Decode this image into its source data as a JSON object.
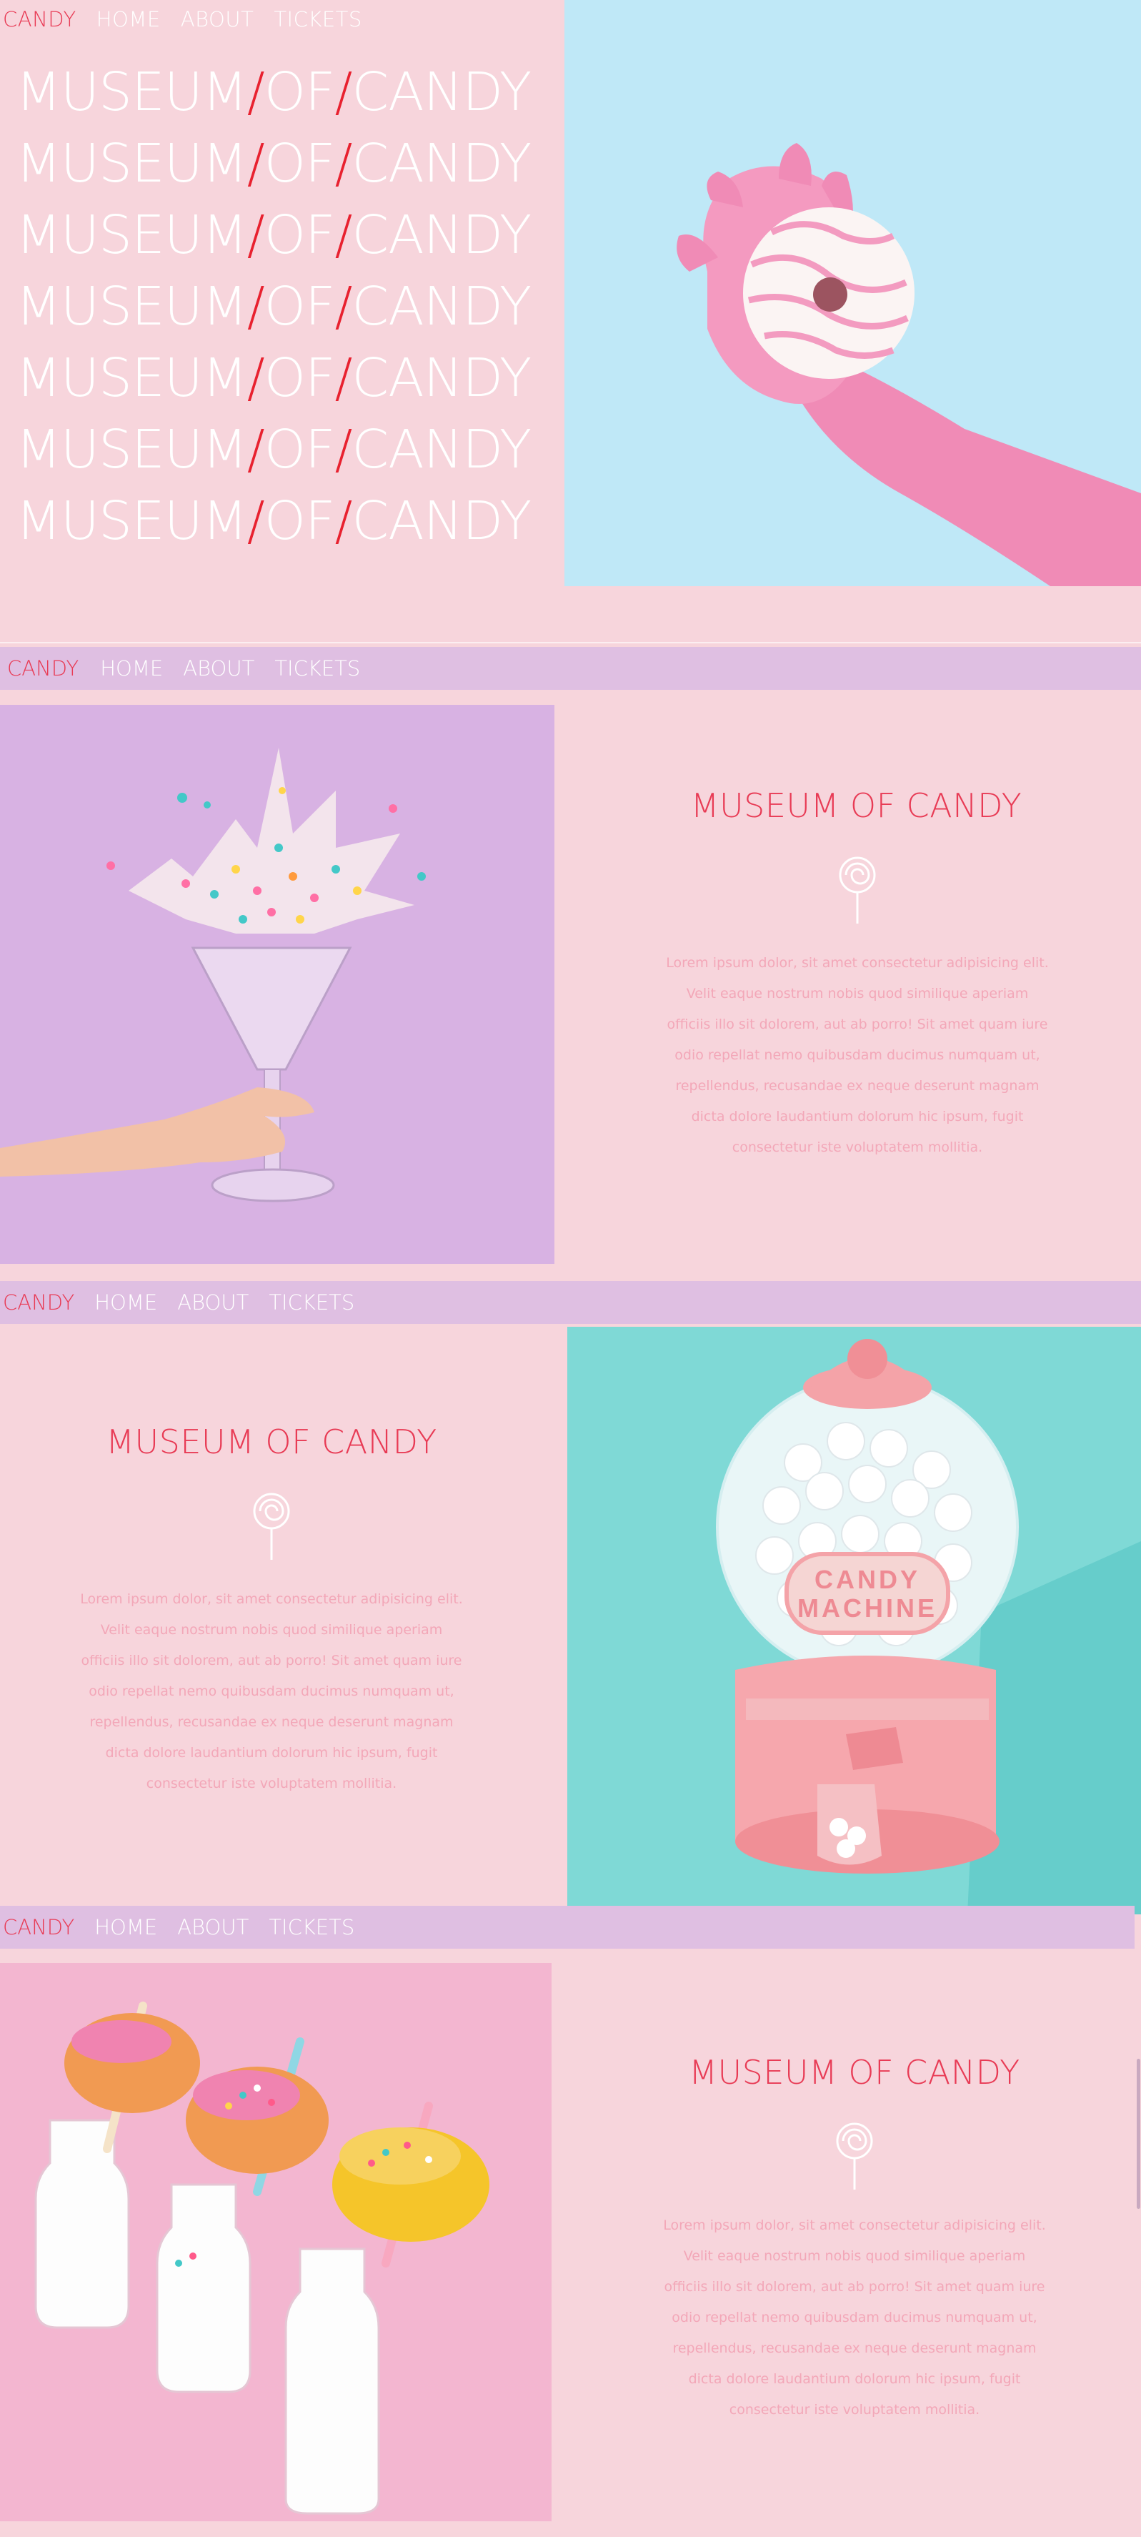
{
  "nav": {
    "brand": "CANDY",
    "links": [
      "HOME",
      "ABOUT",
      "TICKETS"
    ]
  },
  "hero": {
    "lines": [
      {
        "a": "MUSEUM",
        "s1": "/",
        "b": "OF",
        "s2": "/",
        "c": "CANDY"
      },
      {
        "a": "MUSEUM",
        "s1": "/",
        "b": "OF",
        "s2": "/",
        "c": "CANDY"
      },
      {
        "a": "MUSEUM",
        "s1": "/",
        "b": "OF",
        "s2": "/",
        "c": "CANDY"
      },
      {
        "a": "MUSEUM",
        "s1": "/",
        "b": "OF",
        "s2": "/",
        "c": "CANDY"
      },
      {
        "a": "MUSEUM",
        "s1": "/",
        "b": "OF",
        "s2": "/",
        "c": "CANDY"
      },
      {
        "a": "MUSEUM",
        "s1": "/",
        "b": "OF",
        "s2": "/",
        "c": "CANDY"
      },
      {
        "a": "MUSEUM",
        "s1": "/",
        "b": "OF",
        "s2": "/",
        "c": "CANDY"
      }
    ]
  },
  "sections": [
    {
      "title": "MUSEUM OF CANDY",
      "body_lines": [
        "Lorem ipsum dolor, sit amet consectetur adipisicing elit.",
        "Velit eaque nostrum nobis quod similique aperiam",
        "officiis illo sit dolorem, aut ab porro! Sit amet quam iure",
        "odio repellat nemo quibusdam ducimus numquam ut,",
        "repellendus, recusandae ex neque deserunt magnam",
        "dicta dolore laudantium dolorum hic ipsum, fugit",
        "consectetur iste voluptatem mollitia."
      ]
    },
    {
      "title": "MUSEUM OF CANDY",
      "body_lines": [
        "Lorem ipsum dolor, sit amet consectetur adipisicing elit.",
        "Velit eaque nostrum nobis quod similique aperiam",
        "officiis illo sit dolorem, aut ab porro! Sit amet quam iure",
        "odio repellat nemo quibusdam ducimus numquam ut,",
        "repellendus, recusandae ex neque deserunt magnam",
        "dicta dolore laudantium dolorum hic ipsum, fugit",
        "consectetur iste voluptatem mollitia."
      ]
    },
    {
      "title": "MUSEUM OF CANDY",
      "body_lines": [
        "Lorem ipsum dolor, sit amet consectetur adipisicing elit.",
        "Velit eaque nostrum nobis quod similique aperiam",
        "officiis illo sit dolorem, aut ab porro! Sit amet quam iure",
        "odio repellat nemo quibusdam ducimus numquam ut,",
        "repellendus, recusandae ex neque deserunt magnam",
        "dicta dolore laudantium dolorum hic ipsum, fugit",
        "consectetur iste voluptatem mollitia."
      ]
    }
  ],
  "gumball_label": {
    "line1": "CANDY",
    "line2": "MACHINE"
  },
  "colors": {
    "page_bg": "#f7d5dc",
    "nav_bar": "#dfbfe2",
    "accent_red": "#e83b55",
    "slash_red": "#e8212f",
    "lorem_pink": "#f3a7b8",
    "sky_blue": "#bfe8f7",
    "lilac": "#d8b2e3",
    "teal": "#7fd9d6",
    "pink_photo": "#f3b6d0"
  }
}
